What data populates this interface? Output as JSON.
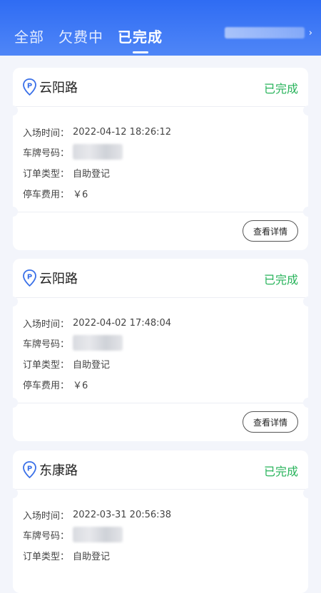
{
  "tabs": [
    {
      "label": "全部"
    },
    {
      "label": "欠费中"
    },
    {
      "label": "已完成"
    }
  ],
  "active_tab": "已完成",
  "colors": {
    "primary": "#2f6cf3",
    "status_done": "#27b35a"
  },
  "labels": {
    "entry_time": "入场时间：",
    "plate": "车牌号码：",
    "order_type": "订单类型：",
    "fee": "停车费用："
  },
  "records": [
    {
      "road": "云阳路",
      "status": "已完成",
      "entry_time": "2022-04-12 18:26:12",
      "order_type": "自助登记",
      "fee": "￥6",
      "detail_label": "查看详情"
    },
    {
      "road": "云阳路",
      "status": "已完成",
      "entry_time": "2022-04-02 17:48:04",
      "order_type": "自助登记",
      "fee": "￥6",
      "detail_label": "查看详情"
    },
    {
      "road": "东康路",
      "status": "已完成",
      "entry_time": "2022-03-31 20:56:38",
      "order_type": "自助登记"
    }
  ]
}
